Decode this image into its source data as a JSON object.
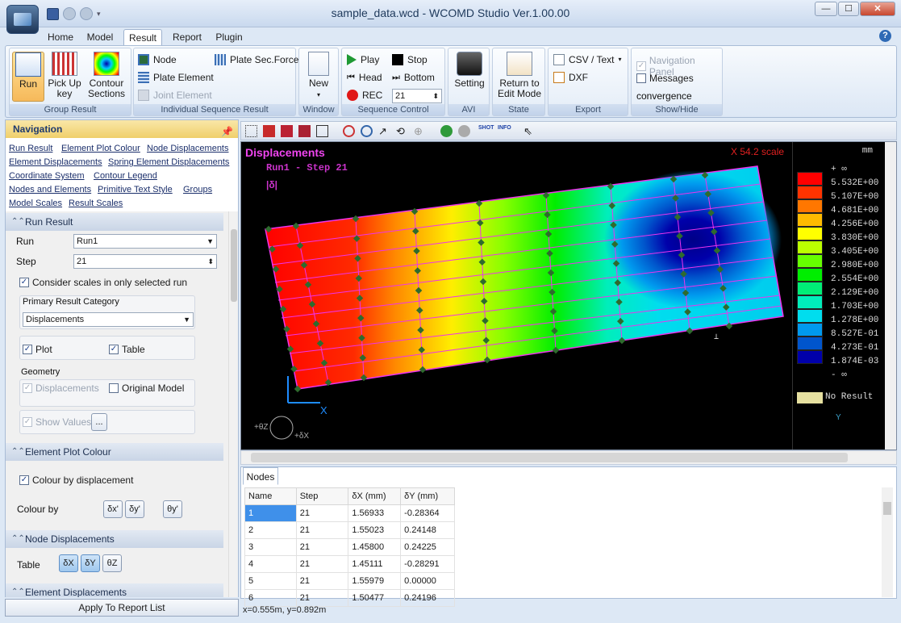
{
  "window": {
    "title": "sample_data.wcd - WCOMD Studio Ver.1.00.00",
    "min": "—",
    "max": "☐",
    "close": "✕"
  },
  "tabs": [
    "Home",
    "Model",
    "Result",
    "Report",
    "Plugin"
  ],
  "help": "?",
  "ribbon": {
    "group_result": {
      "label": "Group Result",
      "run": "Run",
      "pickup": "Pick Up key",
      "contour": "Contour Sections"
    },
    "individual": {
      "label": "Individual Sequence Result",
      "node": "Node",
      "plate_element": "Plate Element",
      "joint_element": "Joint Element",
      "plate_sec_force": "Plate Sec.Force"
    },
    "window": {
      "label": "Window",
      "new": "New"
    },
    "sequence": {
      "label": "Sequence Control",
      "play": "Play",
      "stop": "Stop",
      "head": "Head",
      "bottom": "Bottom",
      "rec": "REC",
      "step": "21"
    },
    "avi": {
      "label": "AVI",
      "setting": "Setting"
    },
    "state": {
      "label": "State",
      "return": "Return to Edit Mode"
    },
    "export": {
      "label": "Export",
      "csv": "CSV / Text",
      "dxf": "DXF"
    },
    "showhide": {
      "label": "Show/Hide",
      "navigation_panel": "Navigation Panel",
      "messages": "Messages",
      "convergence": "convergence"
    }
  },
  "nav": {
    "title": "Navigation",
    "links": [
      "Run Result",
      "Element Plot Colour",
      "Node Displacements",
      "Element Displacements",
      "Spring Element Displacements",
      "Coordinate System",
      "Contour Legend",
      "Nodes and Elements",
      "Primitive Text Style",
      "Groups",
      "Model Scales",
      "Result Scales"
    ],
    "run_result": {
      "header": "Run Result",
      "run_label": "Run",
      "run_value": "Run1",
      "step_label": "Step",
      "step_value": "21",
      "consider_scales": "Consider scales in only selected run",
      "primary_label": "Primary Result Category",
      "primary_value": "Displacements",
      "plot": "Plot",
      "table": "Table",
      "geometry_label": "Geometry",
      "geo_displacements": "Displacements",
      "original_model": "Original Model",
      "show_values": "Show Values",
      "ellipsis": "..."
    },
    "element_plot_colour": {
      "header": "Element Plot Colour",
      "colour_by_displacement": "Colour by displacement",
      "colour_by": "Colour by",
      "b1": "δx'",
      "b2": "δy'",
      "b3": "θy'"
    },
    "node_displacements": {
      "header": "Node Displacements",
      "table": "Table",
      "b1": "δX",
      "b2": "δY",
      "b3": "θZ"
    },
    "element_displacements": {
      "header": "Element Displacements"
    },
    "apply": "Apply To Report List"
  },
  "viewport": {
    "title": "Displacements",
    "subtitle": "Run1 - Step 21",
    "quantity": "|δ|",
    "scale": "X 54.2 scale",
    "unit": "mm",
    "axis_x": "X",
    "axis_y": "Y",
    "rot_z": "+θZ",
    "rot_x": "+δX",
    "legend": [
      {
        "label": "+ ∞",
        "color": ""
      },
      {
        "label": "5.532E+00",
        "color": "#ff0000"
      },
      {
        "label": "5.107E+00",
        "color": "#ff3300"
      },
      {
        "label": "4.681E+00",
        "color": "#ff7700"
      },
      {
        "label": "4.256E+00",
        "color": "#ffbb00"
      },
      {
        "label": "3.830E+00",
        "color": "#ffff00"
      },
      {
        "label": "3.405E+00",
        "color": "#bbff00"
      },
      {
        "label": "2.980E+00",
        "color": "#66ff00"
      },
      {
        "label": "2.554E+00",
        "color": "#00ee00"
      },
      {
        "label": "2.129E+00",
        "color": "#00ee77"
      },
      {
        "label": "1.703E+00",
        "color": "#00eebb"
      },
      {
        "label": "1.278E+00",
        "color": "#00ddee"
      },
      {
        "label": "8.527E-01",
        "color": "#0099ee"
      },
      {
        "label": "4.273E-01",
        "color": "#0055cc"
      },
      {
        "label": "1.874E-03",
        "color": "#0000aa"
      },
      {
        "label": "- ∞",
        "color": ""
      }
    ],
    "no_result": "No Result",
    "legend_y": "Y"
  },
  "table": {
    "tab": "Nodes",
    "columns": [
      "Name",
      "Step",
      "δX (mm)",
      "δY (mm)"
    ],
    "rows": [
      [
        "1",
        "21",
        "1.56933",
        "-0.28364"
      ],
      [
        "2",
        "21",
        "1.55023",
        "0.24148"
      ],
      [
        "3",
        "21",
        "1.45800",
        "0.24225"
      ],
      [
        "4",
        "21",
        "1.45111",
        "-0.28291"
      ],
      [
        "5",
        "21",
        "1.55979",
        "0.00000"
      ],
      [
        "6",
        "21",
        "1.50477",
        "0.24196"
      ]
    ]
  },
  "status": "x=0.555m, y=0.892m"
}
